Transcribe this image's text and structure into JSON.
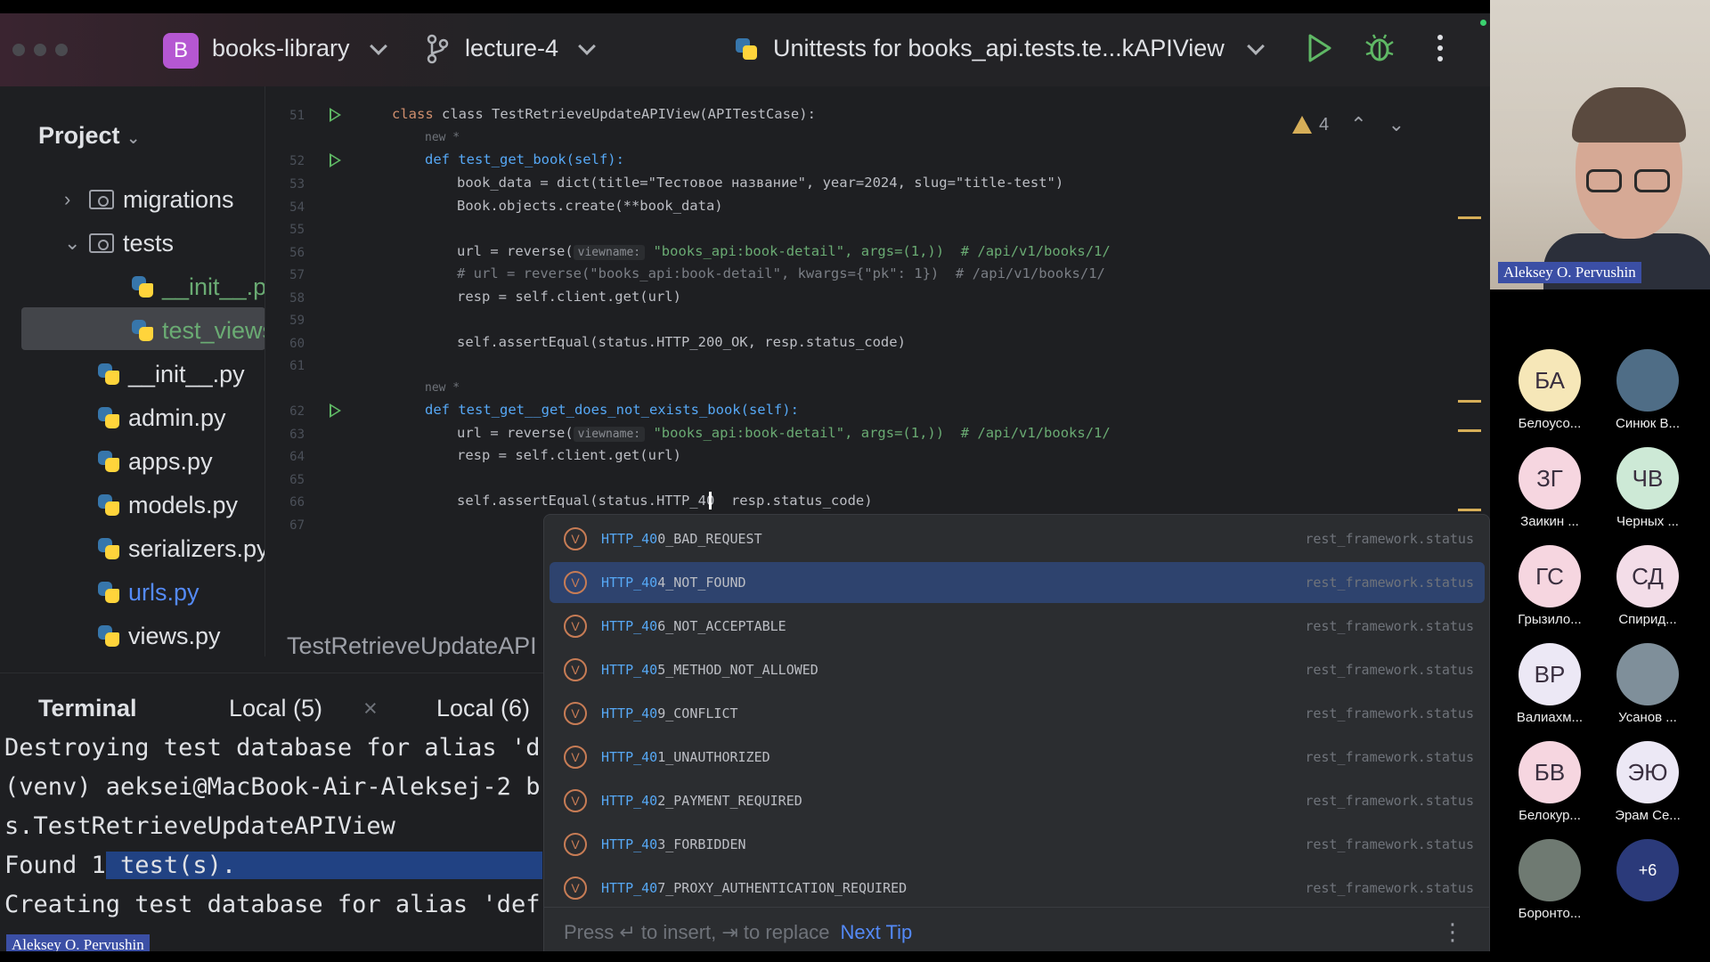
{
  "titlebar": {
    "project_badge": "B",
    "project_name": "books-library",
    "branch": "lecture-4",
    "run_config": "Unittests for books_api.tests.te...kAPIView"
  },
  "project_panel": {
    "title": "Project",
    "items": [
      {
        "label": "migrations",
        "kind": "folder",
        "arrow": "›"
      },
      {
        "label": "tests",
        "kind": "folder",
        "arrow": "⌄"
      },
      {
        "label": "__init__.py",
        "kind": "py",
        "color": "#6aab73"
      },
      {
        "label": "test_views.py",
        "kind": "py",
        "color": "#6aab73"
      },
      {
        "label": "__init__.py",
        "kind": "py"
      },
      {
        "label": "admin.py",
        "kind": "py"
      },
      {
        "label": "apps.py",
        "kind": "py"
      },
      {
        "label": "models.py",
        "kind": "py"
      },
      {
        "label": "serializers.py",
        "kind": "py"
      },
      {
        "label": "urls.py",
        "kind": "py",
        "color": "#548af7"
      },
      {
        "label": "views.py",
        "kind": "py"
      }
    ]
  },
  "editor": {
    "line_numbers": [
      "51",
      "52",
      "53",
      "54",
      "55",
      "56",
      "57",
      "58",
      "59",
      "60",
      "61",
      "62",
      "63",
      "64",
      "65",
      "66",
      "67"
    ],
    "new_tag": "new *",
    "warnings_count": "4",
    "param_hint": "viewname:",
    "lines": {
      "l51": "class TestRetrieveUpdateAPIView(APITestCase):",
      "l52": "def test_get_book(self):",
      "l53": "book_data = dict(title=\"Тестовое название\", year=2024, slug=\"title-test\")",
      "l54": "Book.objects.create(**book_data)",
      "l56a": "url = reverse(",
      "l56b": "\"books_api:book-detail\", args=(1,))  # /api/v1/books/1/",
      "l57": "# url = reverse(\"books_api:book-detail\", kwargs={\"pk\": 1})  # /api/v1/books/1/",
      "l58": "resp = self.client.get(url)",
      "l60": "self.assertEqual(status.HTTP_200_OK, resp.status_code)",
      "l62": "def test_get__get_does_not_exists_book(self):",
      "l63a": "url = reverse(",
      "l63b": "\"books_api:book-detail\", args=(1,))  # /api/v1/books/1/",
      "l64": "resp = self.client.get(url)",
      "l66": "self.assertEqual(status.HTTP_40  resp.status_code)"
    },
    "breadcrumb": "TestRetrieveUpdateAPI"
  },
  "completion": {
    "items": [
      {
        "prefix": "HTTP_40",
        "rest": "0_BAD_REQUEST",
        "source": "rest_framework.status"
      },
      {
        "prefix": "HTTP_40",
        "rest": "4_NOT_FOUND",
        "source": "rest_framework.status"
      },
      {
        "prefix": "HTTP_40",
        "rest": "6_NOT_ACCEPTABLE",
        "source": "rest_framework.status"
      },
      {
        "prefix": "HTTP_40",
        "rest": "5_METHOD_NOT_ALLOWED",
        "source": "rest_framework.status"
      },
      {
        "prefix": "HTTP_40",
        "rest": "9_CONFLICT",
        "source": "rest_framework.status"
      },
      {
        "prefix": "HTTP_40",
        "rest": "1_UNAUTHORIZED",
        "source": "rest_framework.status"
      },
      {
        "prefix": "HTTP_40",
        "rest": "2_PAYMENT_REQUIRED",
        "source": "rest_framework.status"
      },
      {
        "prefix": "HTTP_40",
        "rest": "3_FORBIDDEN",
        "source": "rest_framework.status"
      },
      {
        "prefix": "HTTP_40",
        "rest": "7_PROXY_AUTHENTICATION_REQUIRED",
        "source": "rest_framework.status"
      }
    ],
    "item_icon": "V",
    "footer_hint": "Press ↵ to insert, ⇥ to replace",
    "footer_link": "Next Tip"
  },
  "terminal": {
    "title": "Terminal",
    "tab1": "Local (5)",
    "tab2": "Local (6)",
    "close": "×",
    "lines": [
      "Destroying test database for alias 'd",
      "(venv) aeksei@MacBook-Air-Aleksej-2 b",
      "s.TestRetrieveUpdateAPIView",
      "Found 1",
      "Creating test database for alias 'def"
    ],
    "highlight": " test(s)."
  },
  "speaker_name": "Aleksey O. Pervushin",
  "participants": [
    {
      "initials": "БА",
      "name": "Белоусо...",
      "color": "#f6e7b8"
    },
    {
      "initials": "",
      "name": "Синюк В...",
      "color": "#4f6d86"
    },
    {
      "initials": "ЗГ",
      "name": "Заикин ...",
      "color": "#f6d6e0"
    },
    {
      "initials": "ЧВ",
      "name": "Черных ...",
      "color": "#cde9d6"
    },
    {
      "initials": "ГС",
      "name": "Грызило...",
      "color": "#f6d6e0"
    },
    {
      "initials": "СД",
      "name": "Спирид...",
      "color": "#f3dde8"
    },
    {
      "initials": "ВР",
      "name": "Валиахм...",
      "color": "#ece8f5"
    },
    {
      "initials": "",
      "name": "Усанов ...",
      "color": "#7f8f9a"
    },
    {
      "initials": "БВ",
      "name": "Белокур...",
      "color": "#f6d6e0"
    },
    {
      "initials": "ЭЮ",
      "name": "Эрам Се...",
      "color": "#ece8f5"
    },
    {
      "initials": "",
      "name": "Боронто...",
      "color": "#6f7a72"
    },
    {
      "initials": "+6",
      "name": "",
      "color": "#2b3a7a"
    }
  ]
}
